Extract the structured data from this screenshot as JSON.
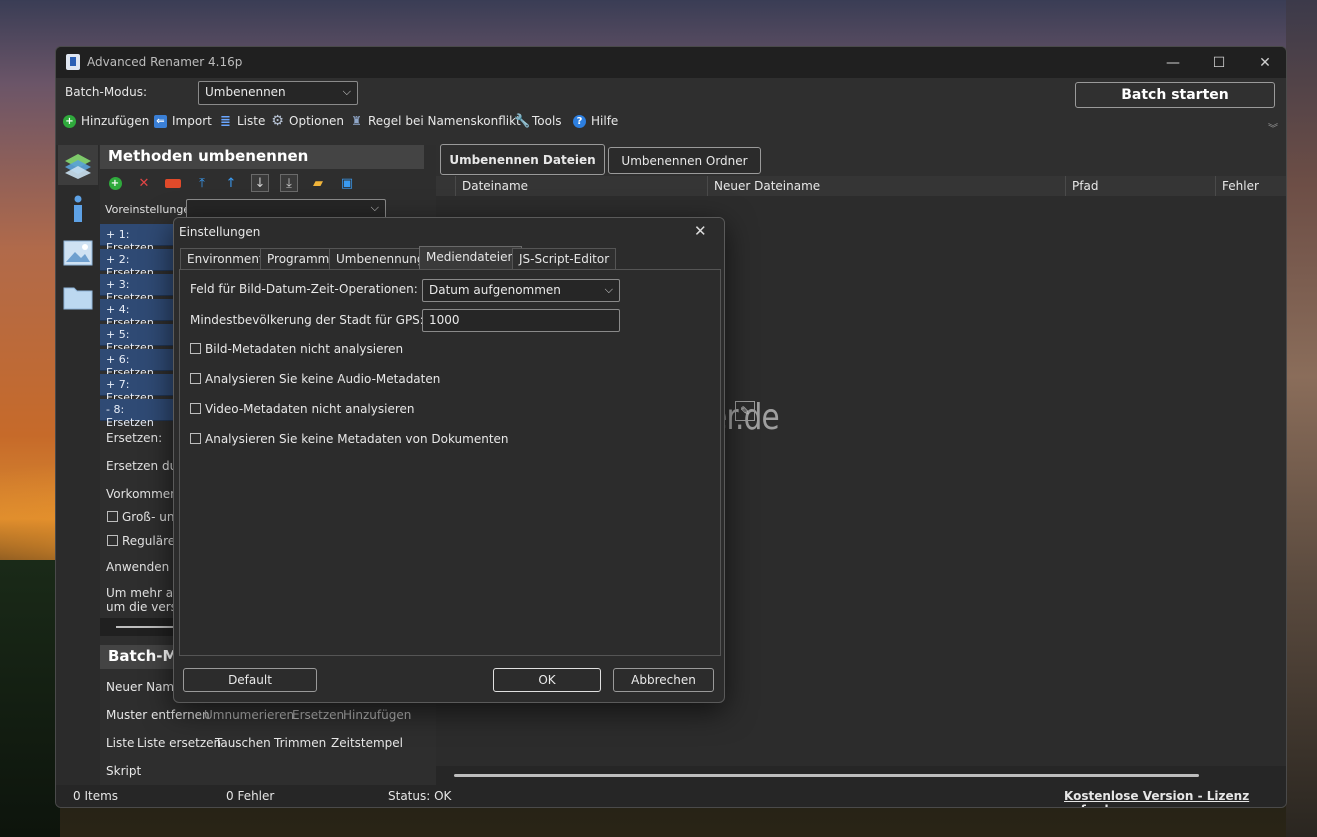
{
  "window": {
    "title": "Advanced Renamer 4.16p",
    "controls": {
      "minimize": "—",
      "maximize": "☐",
      "close": "✕"
    }
  },
  "topbar": {
    "batch_mode_label": "Batch-Modus:",
    "batch_mode_value": "Umbenennen",
    "start_batch": "Batch starten",
    "toolbar": {
      "add": "Hinzufügen",
      "import": "Import",
      "list": "Liste",
      "options": "Optionen",
      "conflict_rule": "Regel bei Namenskonflikt",
      "tools": "Tools",
      "help": "Hilfe"
    }
  },
  "left_panel": {
    "header": "Methoden umbenennen",
    "presets_label": "Voreinstellunge",
    "methods": [
      "+  1: Ersetzen",
      "+  2: Ersetzen",
      "+  3: Ersetzen",
      "+  4: Ersetzen",
      "+  5: Ersetzen",
      "+  6: Ersetzen",
      "+  7: Ersetzen",
      "-  8: Ersetzen"
    ],
    "replace_label": "Ersetzen:",
    "replace_with_label": "Ersetzen durc",
    "occurrence_label": "Vorkommen:",
    "case_label": "Groß- und",
    "regex_label": "Reguläre A",
    "apply_label": "Anwenden a",
    "more_line1": "Um mehr als",
    "more_line2": "um die versc",
    "batch_header": "Batch-Me",
    "new_name_label": "Neuer Name",
    "method_links_row1": [
      "Muster entfernen",
      "Umnumerieren",
      "Ersetzen",
      "Hinzufügen"
    ],
    "method_links_row2": [
      "Liste",
      "Liste ersetzen",
      "Tauschen",
      "Trimmen",
      "Zeitstempel"
    ],
    "script_label": "Skript"
  },
  "right": {
    "tab_files": "Umbenennen Dateien",
    "tab_folders": "Umbenennen Ordner",
    "columns": [
      "Dateiname",
      "Neuer Dateiname",
      "Pfad",
      "Fehler"
    ]
  },
  "status": {
    "items": "0 Items",
    "errors": "0 Fehler",
    "status": "Status: OK",
    "license_link": "Kostenlose Version - Lizenz anfordern"
  },
  "dialog": {
    "title": "Einstellungen",
    "close": "✕",
    "tabs": [
      "Environment",
      "Programm",
      "Umbenennung",
      "Mediendateien",
      "JS-Script-Editor"
    ],
    "active_tab": "Mediendateien",
    "field_label": "Feld für Bild-Datum-Zeit-Operationen:",
    "field_value": "Datum aufgenommen",
    "gps_label": "Mindestbevölkerung der Stadt für GPS:",
    "gps_value": "1000",
    "checkboxes": [
      "Bild-Metadaten nicht analysieren",
      "Analysieren Sie keine Audio-Metadaten",
      "Video-Metadaten nicht analysieren",
      "Analysieren Sie keine Metadaten von Dokumenten"
    ],
    "default_btn": "Default",
    "ok_btn": "OK",
    "cancel_btn": "Abbrechen"
  },
  "watermark": "Deskmodder.de"
}
